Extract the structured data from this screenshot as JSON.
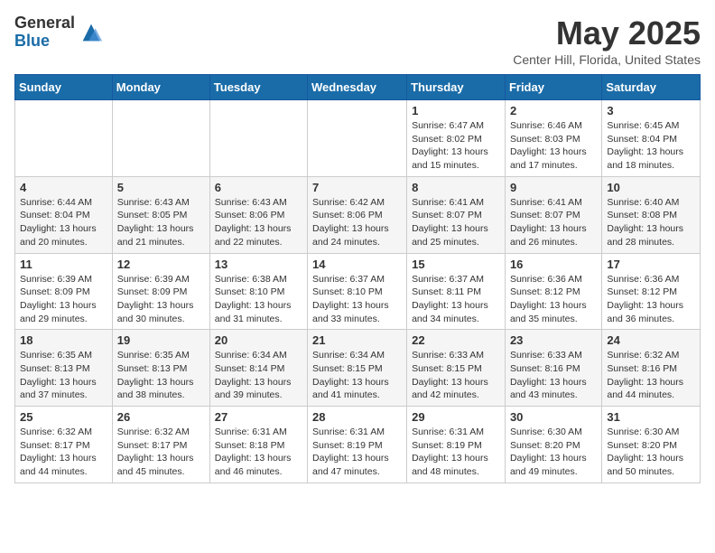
{
  "logo": {
    "general": "General",
    "blue": "Blue"
  },
  "title": "May 2025",
  "location": "Center Hill, Florida, United States",
  "days_of_week": [
    "Sunday",
    "Monday",
    "Tuesday",
    "Wednesday",
    "Thursday",
    "Friday",
    "Saturday"
  ],
  "weeks": [
    [
      {
        "day": "",
        "info": ""
      },
      {
        "day": "",
        "info": ""
      },
      {
        "day": "",
        "info": ""
      },
      {
        "day": "",
        "info": ""
      },
      {
        "day": "1",
        "info": "Sunrise: 6:47 AM\nSunset: 8:02 PM\nDaylight: 13 hours\nand 15 minutes."
      },
      {
        "day": "2",
        "info": "Sunrise: 6:46 AM\nSunset: 8:03 PM\nDaylight: 13 hours\nand 17 minutes."
      },
      {
        "day": "3",
        "info": "Sunrise: 6:45 AM\nSunset: 8:04 PM\nDaylight: 13 hours\nand 18 minutes."
      }
    ],
    [
      {
        "day": "4",
        "info": "Sunrise: 6:44 AM\nSunset: 8:04 PM\nDaylight: 13 hours\nand 20 minutes."
      },
      {
        "day": "5",
        "info": "Sunrise: 6:43 AM\nSunset: 8:05 PM\nDaylight: 13 hours\nand 21 minutes."
      },
      {
        "day": "6",
        "info": "Sunrise: 6:43 AM\nSunset: 8:06 PM\nDaylight: 13 hours\nand 22 minutes."
      },
      {
        "day": "7",
        "info": "Sunrise: 6:42 AM\nSunset: 8:06 PM\nDaylight: 13 hours\nand 24 minutes."
      },
      {
        "day": "8",
        "info": "Sunrise: 6:41 AM\nSunset: 8:07 PM\nDaylight: 13 hours\nand 25 minutes."
      },
      {
        "day": "9",
        "info": "Sunrise: 6:41 AM\nSunset: 8:07 PM\nDaylight: 13 hours\nand 26 minutes."
      },
      {
        "day": "10",
        "info": "Sunrise: 6:40 AM\nSunset: 8:08 PM\nDaylight: 13 hours\nand 28 minutes."
      }
    ],
    [
      {
        "day": "11",
        "info": "Sunrise: 6:39 AM\nSunset: 8:09 PM\nDaylight: 13 hours\nand 29 minutes."
      },
      {
        "day": "12",
        "info": "Sunrise: 6:39 AM\nSunset: 8:09 PM\nDaylight: 13 hours\nand 30 minutes."
      },
      {
        "day": "13",
        "info": "Sunrise: 6:38 AM\nSunset: 8:10 PM\nDaylight: 13 hours\nand 31 minutes."
      },
      {
        "day": "14",
        "info": "Sunrise: 6:37 AM\nSunset: 8:10 PM\nDaylight: 13 hours\nand 33 minutes."
      },
      {
        "day": "15",
        "info": "Sunrise: 6:37 AM\nSunset: 8:11 PM\nDaylight: 13 hours\nand 34 minutes."
      },
      {
        "day": "16",
        "info": "Sunrise: 6:36 AM\nSunset: 8:12 PM\nDaylight: 13 hours\nand 35 minutes."
      },
      {
        "day": "17",
        "info": "Sunrise: 6:36 AM\nSunset: 8:12 PM\nDaylight: 13 hours\nand 36 minutes."
      }
    ],
    [
      {
        "day": "18",
        "info": "Sunrise: 6:35 AM\nSunset: 8:13 PM\nDaylight: 13 hours\nand 37 minutes."
      },
      {
        "day": "19",
        "info": "Sunrise: 6:35 AM\nSunset: 8:13 PM\nDaylight: 13 hours\nand 38 minutes."
      },
      {
        "day": "20",
        "info": "Sunrise: 6:34 AM\nSunset: 8:14 PM\nDaylight: 13 hours\nand 39 minutes."
      },
      {
        "day": "21",
        "info": "Sunrise: 6:34 AM\nSunset: 8:15 PM\nDaylight: 13 hours\nand 41 minutes."
      },
      {
        "day": "22",
        "info": "Sunrise: 6:33 AM\nSunset: 8:15 PM\nDaylight: 13 hours\nand 42 minutes."
      },
      {
        "day": "23",
        "info": "Sunrise: 6:33 AM\nSunset: 8:16 PM\nDaylight: 13 hours\nand 43 minutes."
      },
      {
        "day": "24",
        "info": "Sunrise: 6:32 AM\nSunset: 8:16 PM\nDaylight: 13 hours\nand 44 minutes."
      }
    ],
    [
      {
        "day": "25",
        "info": "Sunrise: 6:32 AM\nSunset: 8:17 PM\nDaylight: 13 hours\nand 44 minutes."
      },
      {
        "day": "26",
        "info": "Sunrise: 6:32 AM\nSunset: 8:17 PM\nDaylight: 13 hours\nand 45 minutes."
      },
      {
        "day": "27",
        "info": "Sunrise: 6:31 AM\nSunset: 8:18 PM\nDaylight: 13 hours\nand 46 minutes."
      },
      {
        "day": "28",
        "info": "Sunrise: 6:31 AM\nSunset: 8:19 PM\nDaylight: 13 hours\nand 47 minutes."
      },
      {
        "day": "29",
        "info": "Sunrise: 6:31 AM\nSunset: 8:19 PM\nDaylight: 13 hours\nand 48 minutes."
      },
      {
        "day": "30",
        "info": "Sunrise: 6:30 AM\nSunset: 8:20 PM\nDaylight: 13 hours\nand 49 minutes."
      },
      {
        "day": "31",
        "info": "Sunrise: 6:30 AM\nSunset: 8:20 PM\nDaylight: 13 hours\nand 50 minutes."
      }
    ]
  ]
}
